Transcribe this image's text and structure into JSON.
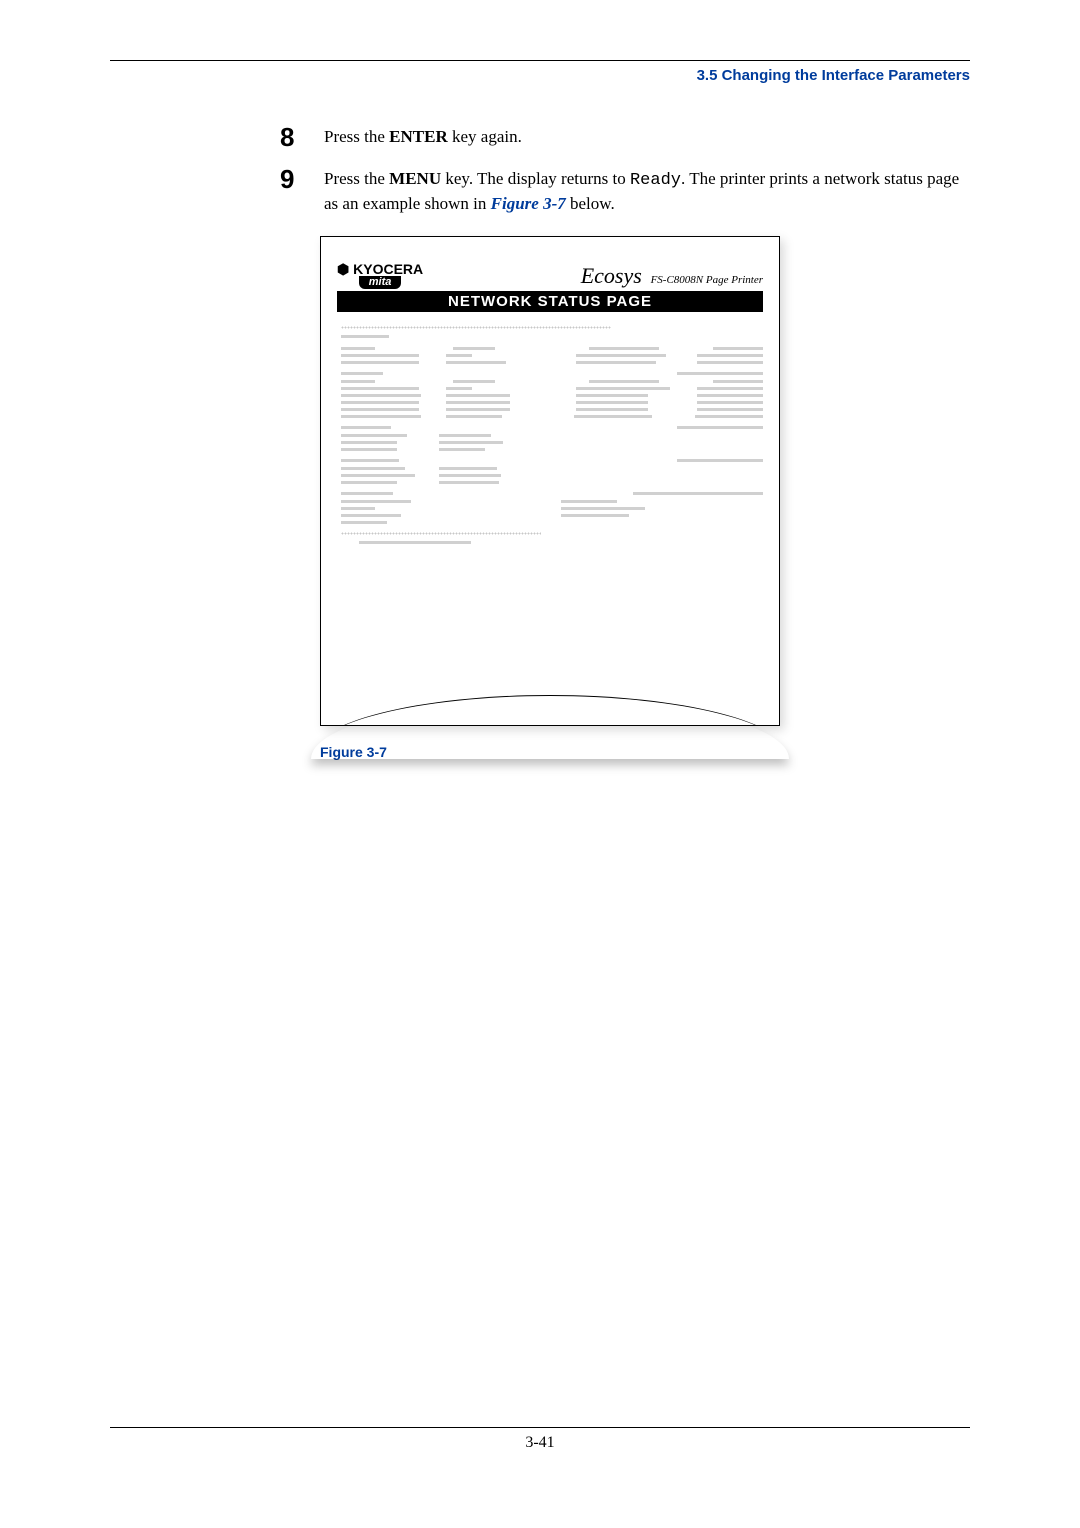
{
  "header": {
    "section": "3.5 Changing the Interface Parameters"
  },
  "steps": [
    {
      "num": "8",
      "prefix": "Press the ",
      "bold1": "ENTER",
      "after1": " key again."
    },
    {
      "num": "9",
      "prefix": "Press the ",
      "bold1": "MENU",
      "after1": " key. The display returns to ",
      "mono": "Ready",
      "after2": ". The printer prints a network status page as an example shown in ",
      "figlink": "Figure 3-7",
      "after3": " below."
    }
  ],
  "status_page": {
    "logo_top": "KYOCERA",
    "logo_sub": "mita",
    "eco": "Ecosys",
    "model": "FS-C8008N Page Printer",
    "title": "NETWORK STATUS PAGE"
  },
  "figure_caption": "Figure 3-7",
  "page_number": "3-41"
}
